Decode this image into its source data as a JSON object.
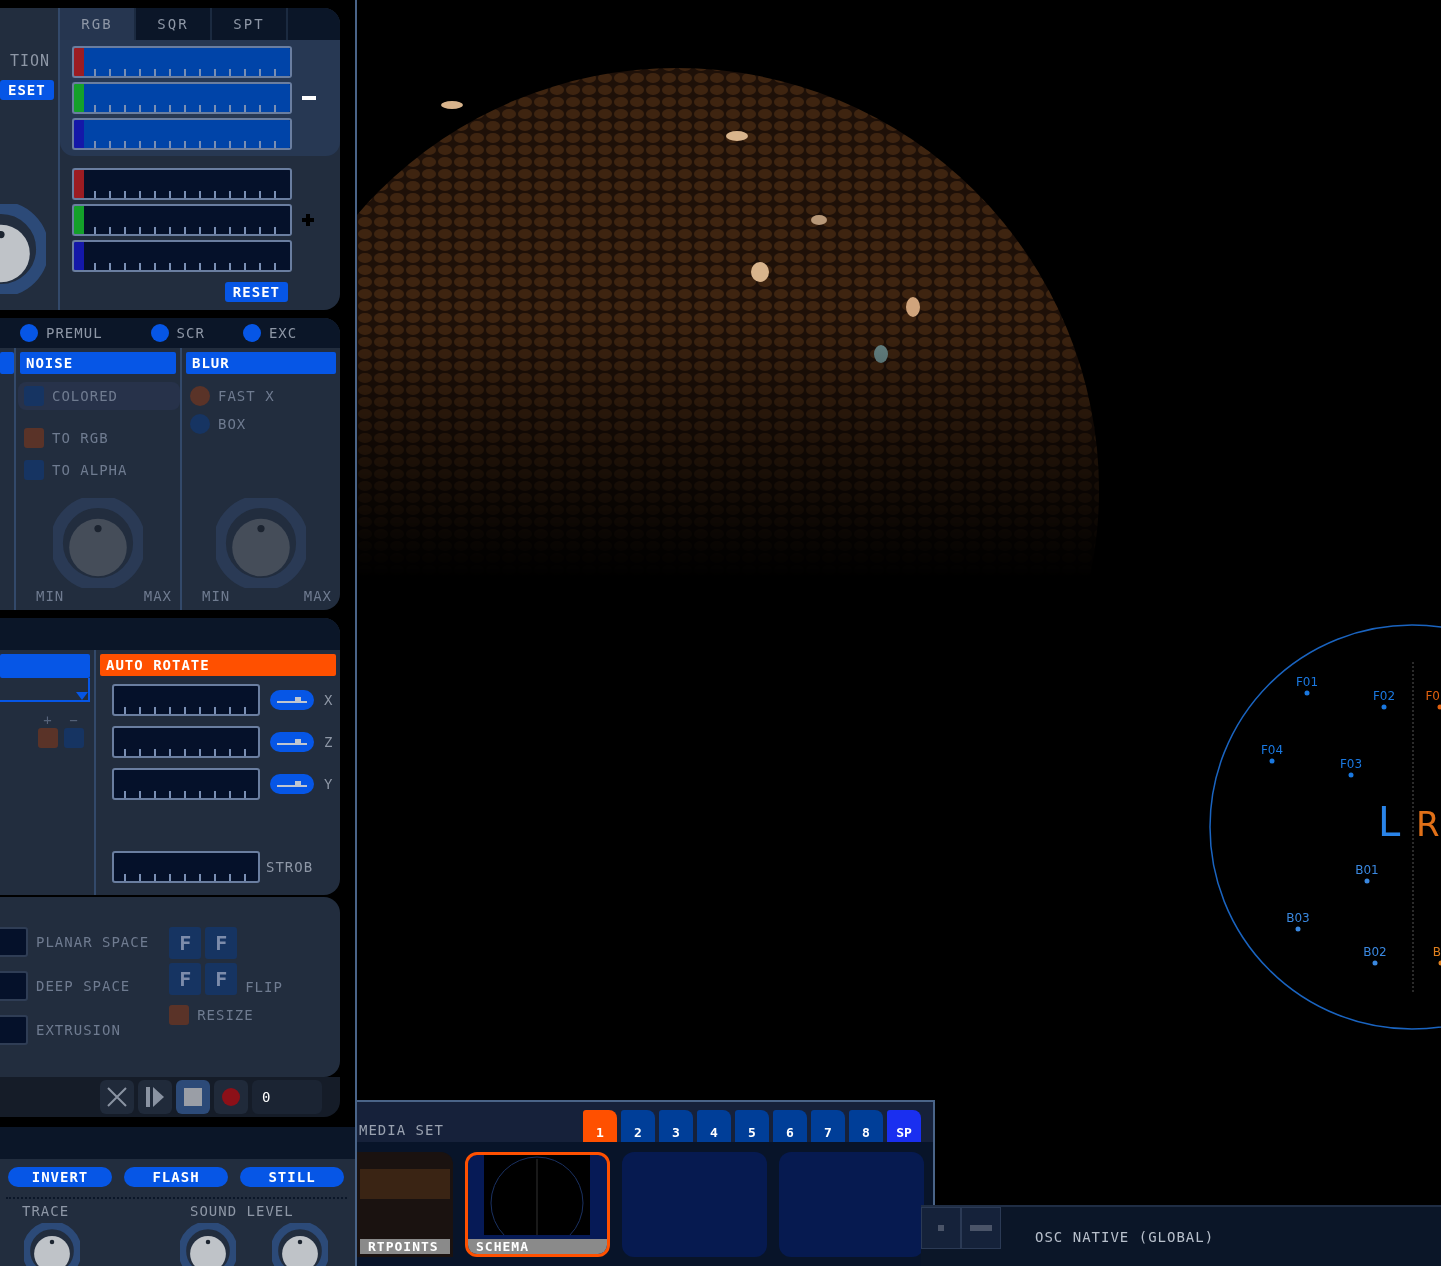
{
  "color_panel": {
    "side_label": "TION",
    "side_reset": "ESET",
    "tabs": [
      {
        "label": "RGB",
        "selected": true
      },
      {
        "label": "SQR",
        "selected": false
      },
      {
        "label": "SPT",
        "selected": false
      }
    ],
    "groups": [
      {
        "kind": "minus",
        "sliders": [
          {
            "color": "#9b1c22",
            "level": 1
          },
          {
            "color": "#14a02a",
            "level": 1
          },
          {
            "color": "#1418a8",
            "level": 1
          }
        ]
      },
      {
        "kind": "plus",
        "sliders": [
          {
            "color": "#9b1c22",
            "level": 0
          },
          {
            "color": "#14a02a",
            "level": 0
          },
          {
            "color": "#1418a8",
            "level": 0
          }
        ]
      }
    ],
    "reset": "RESET"
  },
  "blend": {
    "options": [
      {
        "label": "PREMUL",
        "on": true
      },
      {
        "label": "SCR",
        "on": true
      },
      {
        "label": "EXC",
        "on": true
      }
    ]
  },
  "noise": {
    "title": "NOISE",
    "options": [
      {
        "label": "COLORED",
        "checked": false
      },
      {
        "label": "TO RGB",
        "checked": true
      },
      {
        "label": "TO ALPHA",
        "checked": false
      }
    ],
    "min": "MIN",
    "max": "MAX"
  },
  "blur": {
    "title": "BLUR",
    "options": [
      {
        "label": "FAST X",
        "checked": true
      },
      {
        "label": "BOX",
        "checked": false
      }
    ],
    "min": "MIN",
    "max": "MAX"
  },
  "color_keys": [
    {
      "label": "+",
      "checked": true
    },
    {
      "label": "−",
      "checked": false
    }
  ],
  "rotate": {
    "title": "AUTO ROTATE",
    "axes": [
      {
        "label": "X",
        "on": true,
        "level": 0
      },
      {
        "label": "Z",
        "on": true,
        "level": 0
      },
      {
        "label": "Y",
        "on": true,
        "level": 0
      }
    ],
    "strobe": {
      "label": "STROB",
      "level": 0
    }
  },
  "space": {
    "options": [
      {
        "label": "PLANAR SPACE",
        "level": 0
      },
      {
        "label": "DEEP SPACE",
        "level": 0
      },
      {
        "label": "EXTRUSION",
        "level": 0
      }
    ],
    "flip_keys": [
      "F",
      "F",
      "F",
      "F"
    ],
    "flip": "FLIP",
    "resize": {
      "label": "RESIZE",
      "checked": true
    }
  },
  "transport": {
    "buttons": [
      {
        "kind": "close",
        "selected": false
      },
      {
        "kind": "play",
        "selected": false
      },
      {
        "kind": "stop",
        "selected": true
      },
      {
        "kind": "record",
        "selected": false
      }
    ],
    "counter": "0"
  },
  "effects": {
    "buttons": [
      "INVERT",
      "FLASH",
      "STILL"
    ],
    "labels": [
      "TRACE",
      "SOUND LEVEL"
    ]
  },
  "schema": {
    "left": "L",
    "right": "R",
    "labels": [
      {
        "text": "F01",
        "color": "#1a78e0"
      },
      {
        "text": "F02",
        "color": "#1a78e0"
      },
      {
        "text": "F0",
        "color": "#e0600e"
      },
      {
        "text": "F04",
        "color": "#1a78e0"
      },
      {
        "text": "F03",
        "color": "#1a78e0"
      },
      {
        "text": "B01",
        "color": "#3a88e0"
      },
      {
        "text": "B03",
        "color": "#3a88e0"
      },
      {
        "text": "B02",
        "color": "#3a88e0"
      },
      {
        "text": "B",
        "color": "#e0801e"
      }
    ]
  },
  "media_set": {
    "title": "MEDIA SET",
    "tabs": [
      {
        "label": "1",
        "selected": true,
        "kind": "slot"
      },
      {
        "label": "2",
        "selected": false,
        "kind": "slot"
      },
      {
        "label": "3",
        "selected": false,
        "kind": "slot"
      },
      {
        "label": "4",
        "selected": false,
        "kind": "slot"
      },
      {
        "label": "5",
        "selected": false,
        "kind": "slot"
      },
      {
        "label": "6",
        "selected": false,
        "kind": "slot"
      },
      {
        "label": "7",
        "selected": false,
        "kind": "slot"
      },
      {
        "label": "8",
        "selected": false,
        "kind": "slot"
      },
      {
        "label": "SP",
        "selected": false,
        "kind": "special"
      }
    ],
    "clips": [
      {
        "kind": "scene",
        "title": "RTPOINTS",
        "selected": false
      },
      {
        "kind": "schema",
        "title": "SCHEMA",
        "selected": true
      },
      {
        "kind": "empty",
        "selected": false
      },
      {
        "kind": "empty",
        "selected": false
      }
    ]
  },
  "osc": {
    "label": "OSC NATIVE (GLOBAL)"
  }
}
